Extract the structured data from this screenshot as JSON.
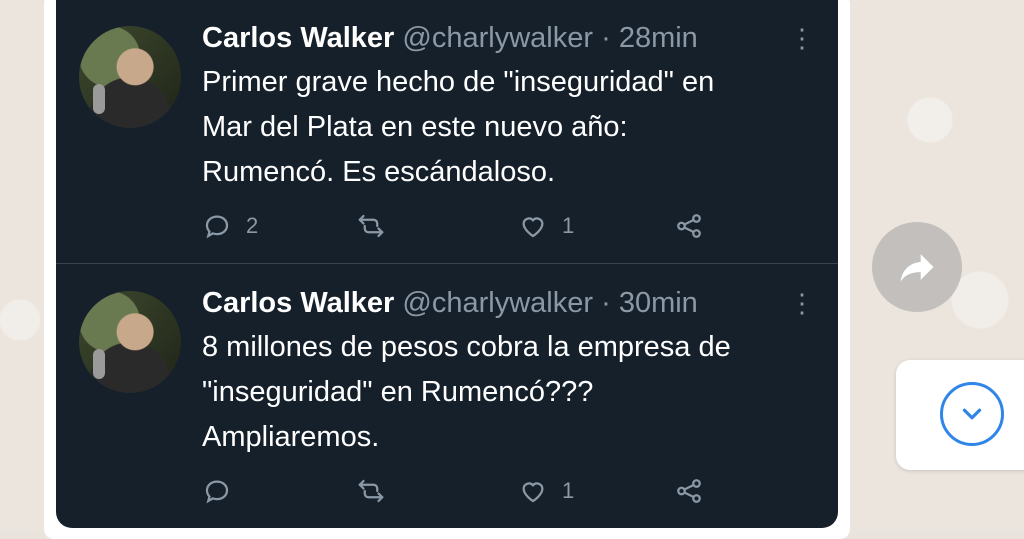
{
  "tweets": [
    {
      "name": "Carlos Walker",
      "handle": "@charlywalker",
      "separator": "·",
      "time": "28min",
      "more": "⋮",
      "lines": [
        "Primer grave hecho de \"inseguridad\" en",
        "Mar del Plata en este nuevo año:",
        "Rumencó. Es escándaloso."
      ],
      "replies": "2",
      "retweets": "",
      "likes": "1"
    },
    {
      "name": "Carlos Walker",
      "handle": "@charlywalker",
      "separator": "·",
      "time": "30min",
      "more": "⋮",
      "lines": [
        "8 millones de pesos cobra la empresa de",
        "\"inseguridad\" en Rumencó???",
        "Ampliaremos."
      ],
      "replies": "",
      "retweets": "",
      "likes": "1"
    }
  ],
  "colors": {
    "tweet_bg": "#15202b",
    "text": "#ffffff",
    "muted": "#8b98a5",
    "accent": "#2f86e8"
  },
  "icons": {
    "reply": "reply-icon",
    "retweet": "retweet-icon",
    "like": "heart-icon",
    "share": "share-icon",
    "forward": "forward-arrow-icon",
    "scroll_down": "chevron-down-icon"
  }
}
